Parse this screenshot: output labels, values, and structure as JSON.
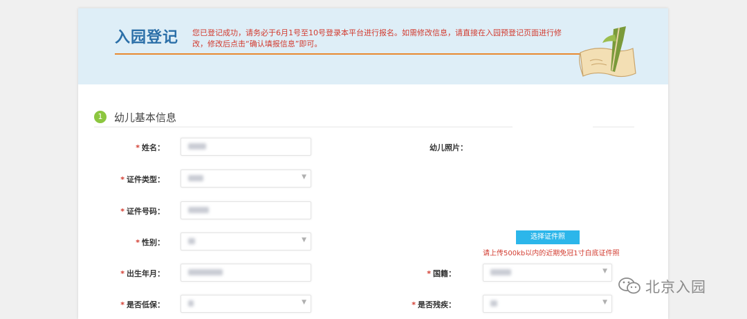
{
  "header": {
    "title": "入园登记",
    "notice": "您已登记成功，请务必于6月1号至10号登录本平台进行报名。如需修改信息，请直接在入园预登记页面进行修改，修改后点击“确认填报信息”即可。"
  },
  "section": {
    "number": "1",
    "title": "幼儿基本信息"
  },
  "form": {
    "required_mark": "*",
    "name_label": "姓名：",
    "id_type_label": "证件类型：",
    "id_number_label": "证件号码：",
    "gender_label": "性别：",
    "birth_label": "出生年月：",
    "low_income_label": "是否低保：",
    "photo_label": "幼儿照片：",
    "nationality_label": "国籍：",
    "disability_label": "是否残疾："
  },
  "photo": {
    "button_label": "选择证件照",
    "hint": "请上传500kb以内的近期免冠1寸白底证件照"
  },
  "watermark": {
    "text": "北京入园"
  },
  "colors": {
    "title_blue": "#2b6fa8",
    "notice_red": "#d23b2f",
    "accent_orange": "#e8892f",
    "header_bg": "#deeef7",
    "step_green": "#8cc63f",
    "button_blue": "#2cb6ea"
  },
  "icons": {
    "decoration": "scroll-quill-icon",
    "watermark": "wechat-icon",
    "select": "caret-down-icon"
  }
}
